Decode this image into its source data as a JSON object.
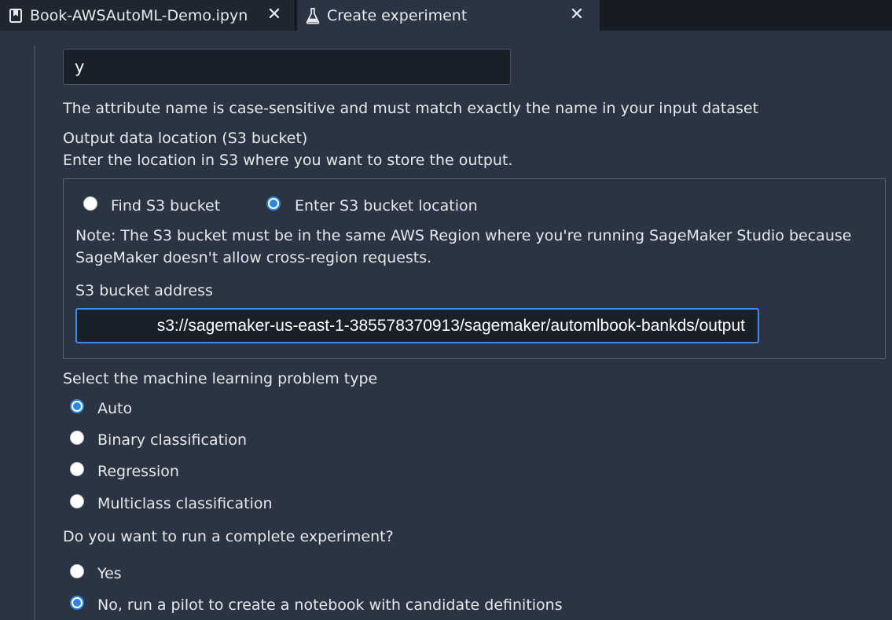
{
  "tabs": [
    {
      "label": "Book-AWSAutoML-Demo.ipyn",
      "icon": "bookmark-icon",
      "close": "✕"
    },
    {
      "label": "Create experiment",
      "icon": "flask-icon",
      "close": "✕"
    }
  ],
  "target": {
    "value": "y",
    "help": "The attribute name is case-sensitive and must match exactly the name in your input dataset"
  },
  "output": {
    "title": "Output data location (S3 bucket)",
    "subtitle": "Enter the location in S3 where you want to store the output.",
    "options": [
      "Find S3 bucket",
      "Enter S3 bucket location"
    ],
    "selected": "Enter S3 bucket location",
    "note_line1": "Note: The S3 bucket must be in the same AWS Region where you're running SageMaker Studio because",
    "note_line2": "SageMaker doesn't allow cross-region requests.",
    "address_label": "S3 bucket address",
    "address_value": "s3://sagemaker-us-east-1-385578370913/sagemaker/automlbook-bankds/output"
  },
  "problem_type": {
    "title": "Select the machine learning problem type",
    "options": [
      "Auto",
      "Binary classification",
      "Regression",
      "Multiclass classification"
    ],
    "selected": "Auto"
  },
  "complete_experiment": {
    "title": "Do you want to run a complete experiment?",
    "options": [
      "Yes",
      "No, run a pilot to create a notebook with candidate definitions"
    ],
    "selected": "No, run a pilot to create a notebook with candidate definitions"
  },
  "colors": {
    "accent": "#2e86de",
    "background": "#2b3442",
    "tabbar": "#171c24"
  }
}
